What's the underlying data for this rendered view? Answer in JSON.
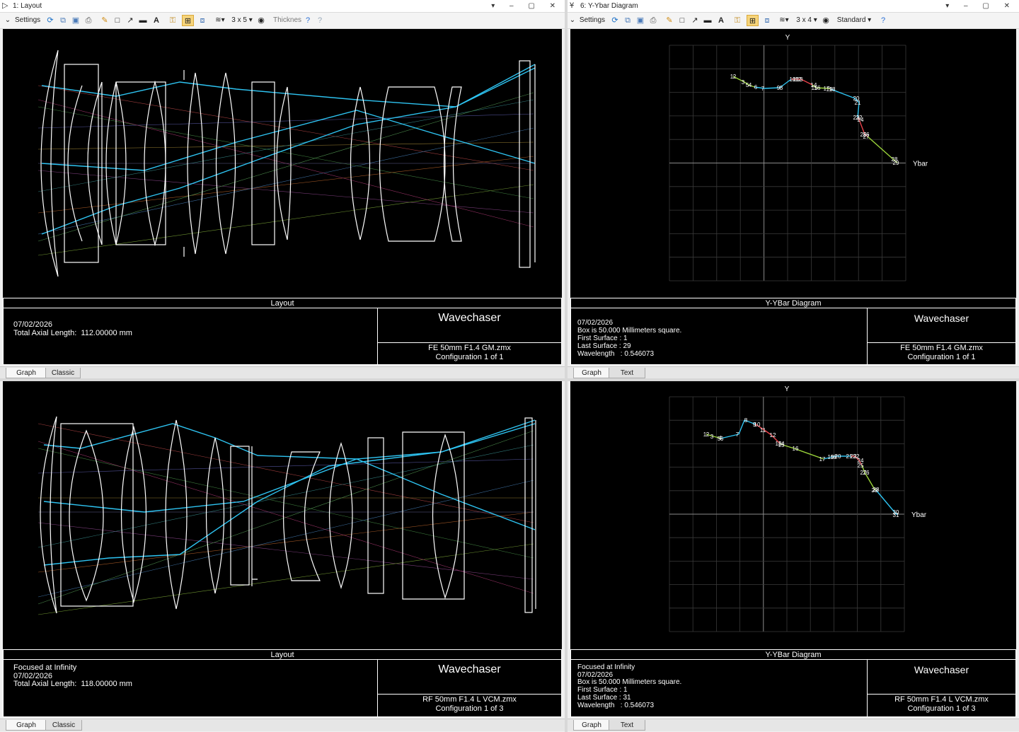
{
  "windows": [
    {
      "title": "1: Layout",
      "toolbar": {
        "settings": "Settings",
        "grid": "3 x 5",
        "extra": "Thickness"
      },
      "caption": "Layout",
      "info": [
        "07/02/2026",
        "Total Axial Length:  112.00000 mm"
      ],
      "brand": "Wavechaser",
      "file": "FE 50mm F1.4 GM.zmx",
      "config": "Configuration 1 of 1",
      "tabs": [
        "Graph",
        "Classic"
      ]
    },
    {
      "title": "6: Y-Ybar Diagram",
      "toolbar": {
        "settings": "Settings",
        "grid": "3 x 4",
        "extra": "Standard"
      },
      "caption": "Y-YBar Diagram",
      "axis_y": "Y",
      "axis_x": "Ybar",
      "info": [
        "07/02/2026",
        "Box is 50.000 Millimeters square.",
        "First Surface : 1",
        "Last Surface : 29",
        "Wavelength   : 0.546073"
      ],
      "brand": "Wavechaser",
      "file": "FE 50mm F1.4 GM.zmx",
      "config": "Configuration 1 of 1",
      "tabs": [
        "Graph",
        "Text"
      ]
    },
    {
      "title": "",
      "caption": "Layout",
      "info": [
        "Focused at Infinity",
        "07/02/2026",
        "Total Axial Length:  118.00000 mm"
      ],
      "brand": "Wavechaser",
      "file": "RF 50mm F1.4 L VCM.zmx",
      "config": "Configuration 1 of 3",
      "tabs": [
        "Graph",
        "Classic"
      ]
    },
    {
      "title": "",
      "caption": "Y-YBar Diagram",
      "axis_y": "Y",
      "axis_x": "Ybar",
      "info": [
        "Focused at Infinity",
        "07/02/2026",
        "Box is 50.000 Millimeters square.",
        "First Surface : 1",
        "Last Surface : 31",
        "Wavelength   : 0.546073"
      ],
      "brand": "Wavechaser",
      "file": "RF 50mm F1.4 L VCM.zmx",
      "config": "Configuration 1 of 3",
      "tabs": [
        "Graph",
        "Text"
      ]
    }
  ],
  "colors": {
    "ray_blue": "#2ec4f2",
    "ray_green": "#9bd43a",
    "ray_red": "#e8424a",
    "lens": "#ffffff",
    "bg": "#000000",
    "grid": "#3a3a3a"
  },
  "chart_data": [
    {
      "type": "line",
      "title": "Y-YBar Diagram",
      "xlabel": "Ybar",
      "ylabel": "Y",
      "grid": true,
      "point_labels": [
        "1",
        "2",
        "3",
        "4",
        "5",
        "6",
        "7",
        "8",
        "9",
        "10",
        "11",
        "12",
        "13",
        "14",
        "15",
        "16",
        "17",
        "18",
        "19",
        "20",
        "21",
        "22",
        "23",
        "24",
        "25",
        "26",
        "27",
        "28",
        "29"
      ]
    },
    {
      "type": "line",
      "title": "Y-YBar Diagram",
      "xlabel": "Ybar",
      "ylabel": "Y",
      "grid": true,
      "point_labels": [
        "1",
        "2",
        "3",
        "4",
        "5",
        "6",
        "7",
        "8",
        "9",
        "10",
        "11",
        "12",
        "13",
        "14",
        "15",
        "16",
        "17",
        "18",
        "19",
        "20",
        "21",
        "22",
        "23",
        "24",
        "25",
        "26",
        "27",
        "28",
        "29",
        "30",
        "31"
      ]
    }
  ]
}
